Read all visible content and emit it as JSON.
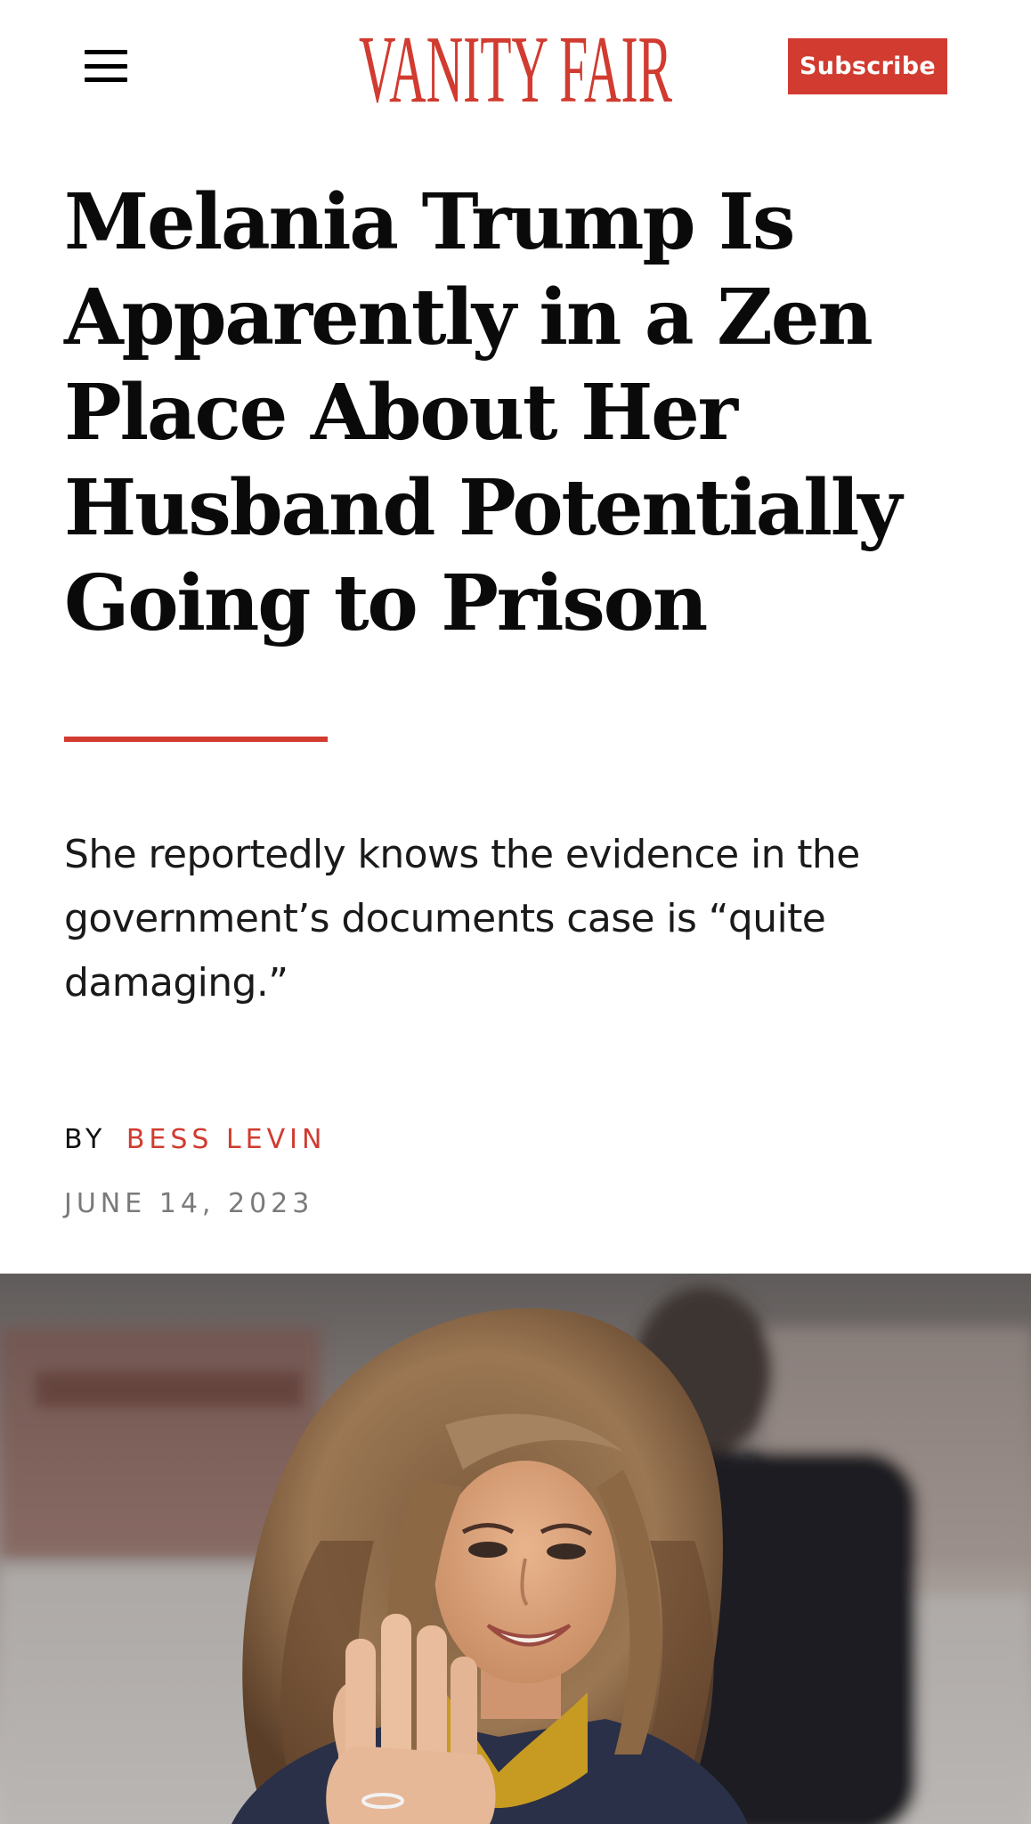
{
  "header": {
    "logo_text": "VANITY FAIR",
    "subscribe_label": "Subscribe",
    "menu_icon": "hamburger-menu-icon",
    "brand_color": "#d13b30"
  },
  "article": {
    "headline_lines": [
      "Melania Trump Is",
      "Apparently in a Zen",
      "Place About Her",
      "Husband Potentially",
      "Going to Prison"
    ],
    "dek_lines": [
      "She reportedly knows the evidence in the",
      "government’s documents case is “quite",
      "damaging.”"
    ],
    "byline_prefix": "BY",
    "author": "BESS LEVIN",
    "date": "JUNE 14, 2023"
  },
  "hero_image": {
    "subject": "photo-woman-smiling-waving"
  }
}
